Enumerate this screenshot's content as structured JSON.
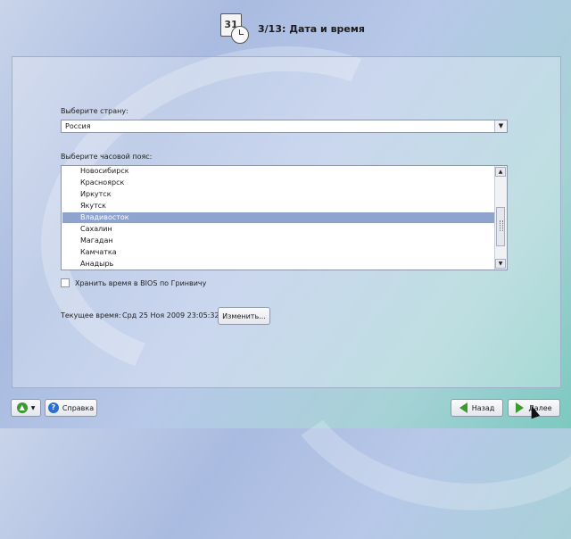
{
  "header": {
    "calendar_day": "31",
    "title": "3/13: Дата и время"
  },
  "country": {
    "label": "Выберите страну:",
    "selected": "Россия"
  },
  "timezone": {
    "label": "Выберите часовой пояс:",
    "items": [
      "Новосибирск",
      "Красноярск",
      "Иркутск",
      "Якутск",
      "Владивосток",
      "Сахалин",
      "Магадан",
      "Камчатка",
      "Анадырь"
    ],
    "selected_index": 4
  },
  "bios_checkbox": {
    "label": "Хранить время в BIOS по Гринвичу",
    "checked": false
  },
  "current_time": {
    "label": "Текущее время:",
    "value": "Срд 25 Ноя 2009 23:05:32",
    "change_button": "Изменить..."
  },
  "footer": {
    "help_button": "Справка",
    "back_button": "Назад",
    "next_button": "Далее"
  },
  "colors": {
    "selection": "#8ea4cf",
    "arrow_green": "#3c9a2e",
    "help_blue": "#2a6fd1"
  }
}
